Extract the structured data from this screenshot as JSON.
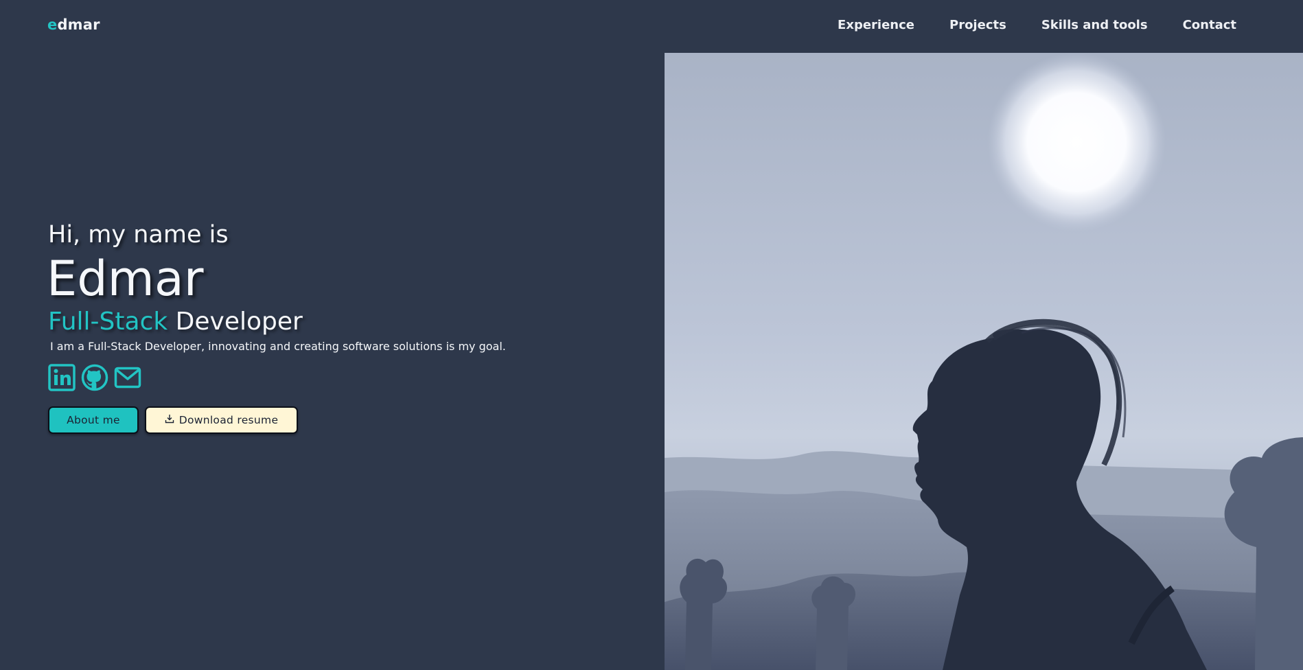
{
  "header": {
    "logo_accent": "e",
    "logo_rest": "dmar",
    "nav": [
      {
        "label": "Experience"
      },
      {
        "label": "Projects"
      },
      {
        "label": "Skills and tools"
      },
      {
        "label": "Contact"
      }
    ]
  },
  "hero": {
    "greeting": "Hi, my name is",
    "name": "Edmar",
    "role_accent": "Full-Stack",
    "role_rest": "Developer",
    "description": "I am a Full-Stack Developer, innovating and creating software solutions is my goal.",
    "social_icons": [
      "linkedin-icon",
      "github-icon",
      "mail-icon"
    ],
    "about_button": "About me",
    "resume_button": "Download resume"
  },
  "photo": {
    "subject": "silhouette-profile-photo"
  },
  "colors": {
    "background": "#2e384b",
    "accent": "#22c4c4",
    "resume_button_bg": "#fff6d6"
  }
}
